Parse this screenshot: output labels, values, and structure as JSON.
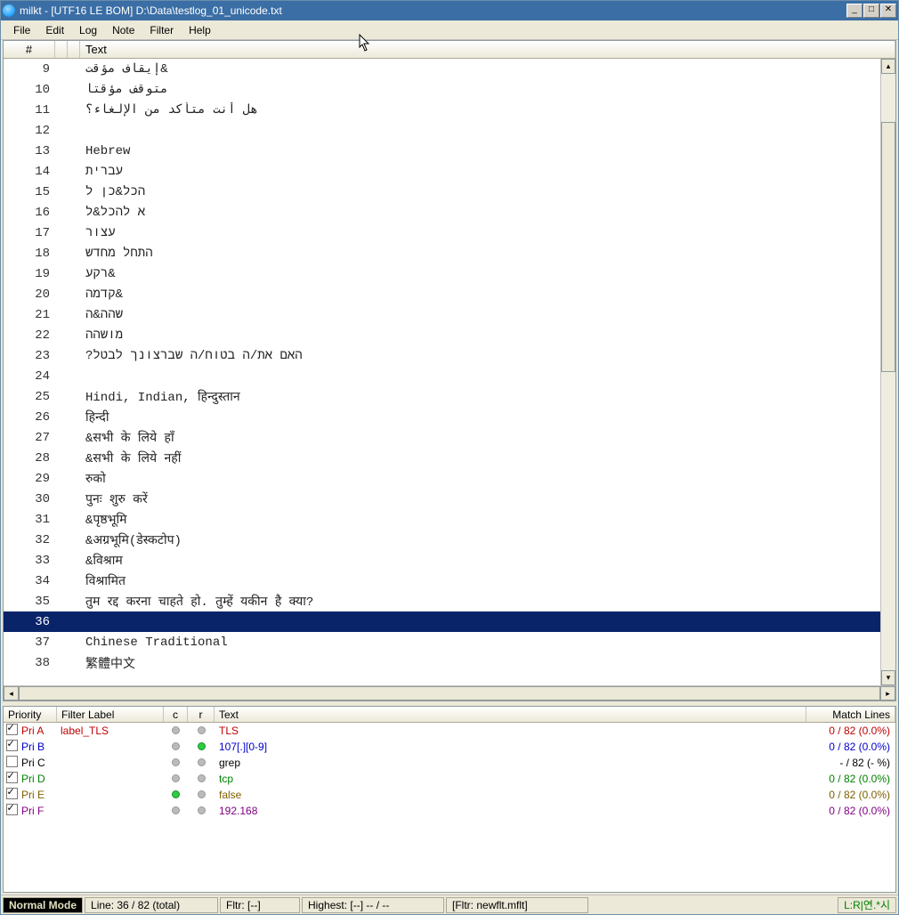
{
  "title": "milkt - [UTF16 LE BOM] D:\\Data\\testlog_01_unicode.txt",
  "menu": [
    "File",
    "Edit",
    "Log",
    "Note",
    "Filter",
    "Help"
  ],
  "main_header": {
    "hash": "#",
    "text": "Text"
  },
  "selected_line": 36,
  "rows": [
    {
      "n": 9,
      "t": "إيقاف  مؤقت&"
    },
    {
      "n": 10,
      "t": "متوقف  مؤقتا"
    },
    {
      "n": 11,
      "t": "هل  أنت  متأكد  من  الإلغاء؟"
    },
    {
      "n": 12,
      "t": ""
    },
    {
      "n": 13,
      "t": "Hebrew"
    },
    {
      "n": 14,
      "t": "עברית"
    },
    {
      "n": 15,
      "t": "הכל&כן ל"
    },
    {
      "n": 16,
      "t": "א להכל&ל"
    },
    {
      "n": 17,
      "t": "עצור"
    },
    {
      "n": 18,
      "t": "התחל מחדש"
    },
    {
      "n": 19,
      "t": "רקע&"
    },
    {
      "n": 20,
      "t": "קדמה&"
    },
    {
      "n": 21,
      "t": "שהה&ה"
    },
    {
      "n": 22,
      "t": "מושהה"
    },
    {
      "n": 23,
      "t": "?האם את/ה בטוח/ה שברצונך לבטל"
    },
    {
      "n": 24,
      "t": ""
    },
    {
      "n": 25,
      "t": "Hindi, Indian, हिन्दुस्तान"
    },
    {
      "n": 26,
      "t": "हिन्दी"
    },
    {
      "n": 27,
      "t": "&सभी के लिये हाँ"
    },
    {
      "n": 28,
      "t": "&सभी के लिये नहीं"
    },
    {
      "n": 29,
      "t": "रुको"
    },
    {
      "n": 30,
      "t": "पुनः शुरु करें"
    },
    {
      "n": 31,
      "t": "&पृष्ठभूमि"
    },
    {
      "n": 32,
      "t": "&अग्रभूमि(डेस्कटोप)"
    },
    {
      "n": 33,
      "t": "&विश्राम"
    },
    {
      "n": 34,
      "t": "विश्रामित"
    },
    {
      "n": 35,
      "t": "तुम रद्द करना चाहते हो. तुम्हें यकीन है क्या?"
    },
    {
      "n": 36,
      "t": ""
    },
    {
      "n": 37,
      "t": "Chinese Traditional"
    },
    {
      "n": 38,
      "t": "繁體中文"
    }
  ],
  "filter_header": {
    "priority": "Priority",
    "label": "Filter Label",
    "c": "c",
    "r": "r",
    "text": "Text",
    "match": "Match Lines"
  },
  "filters": [
    {
      "checked": true,
      "pri": "Pri A",
      "pri_color": "#c00000",
      "label": "label_TLS",
      "c": "gray",
      "r": "gray",
      "text": "TLS",
      "text_color": "#c00000",
      "match": "0 / 82 (0.0%)",
      "match_color": "#c00000"
    },
    {
      "checked": true,
      "pri": "Pri B",
      "pri_color": "#0000cc",
      "label": "",
      "c": "gray",
      "r": "green",
      "text": "107[.][0-9]",
      "text_color": "#0000cc",
      "match": "0 / 82 (0.0%)",
      "match_color": "#0000cc"
    },
    {
      "checked": false,
      "pri": "Pri C",
      "pri_color": "#000000",
      "label": "",
      "c": "gray",
      "r": "gray",
      "text": "grep",
      "text_color": "#000000",
      "match": "- / 82 (- %)",
      "match_color": "#000000"
    },
    {
      "checked": true,
      "pri": "Pri D",
      "pri_color": "#008000",
      "label": "",
      "c": "gray",
      "r": "gray",
      "text": "tcp",
      "text_color": "#008000",
      "match": "0 / 82 (0.0%)",
      "match_color": "#008000"
    },
    {
      "checked": true,
      "pri": "Pri E",
      "pri_color": "#806000",
      "label": "",
      "c": "green",
      "r": "gray",
      "text": "false",
      "text_color": "#806000",
      "match": "0 / 82 (0.0%)",
      "match_color": "#806000"
    },
    {
      "checked": true,
      "pri": "Pri F",
      "pri_color": "#800080",
      "label": "",
      "c": "gray",
      "r": "gray",
      "text": "192.168",
      "text_color": "#800080",
      "match": "0 / 82 (0.0%)",
      "match_color": "#800080"
    }
  ],
  "status": {
    "mode": "Normal Mode",
    "line": "Line: 36 / 82 (total)",
    "fltr": "Fltr: [--]",
    "highest": "Highest: [--] -- / --",
    "fltr_file": "[Fltr: newflt.mflt]",
    "enc": "L:R|연.*시"
  }
}
